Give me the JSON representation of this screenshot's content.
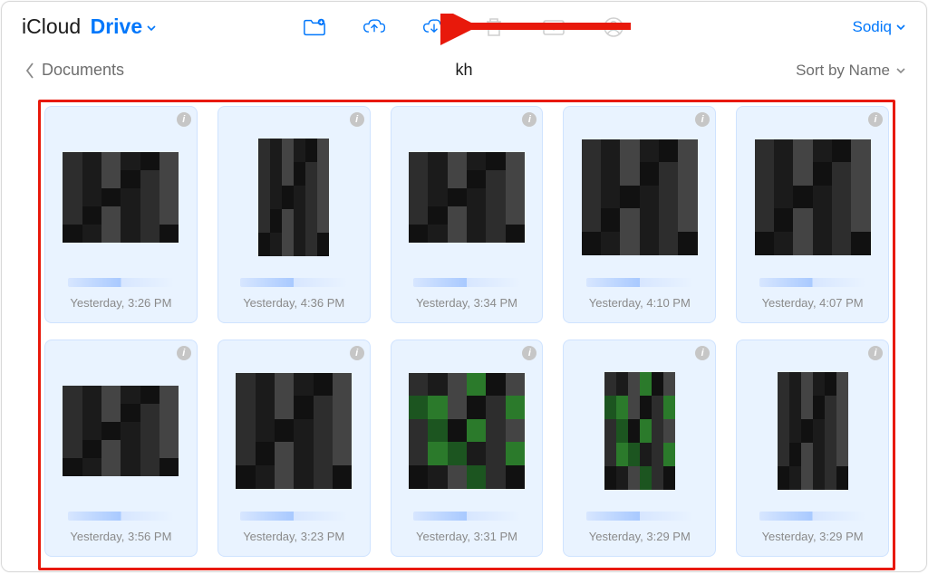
{
  "brand": {
    "part1": "iCloud",
    "part2": "Drive"
  },
  "user": "Sodiq",
  "nav": {
    "back_label": "Documents",
    "folder": "kh",
    "sort_label": "Sort by Name"
  },
  "toolbar": {
    "new_folder": "new-folder",
    "upload": "upload",
    "download": "download",
    "delete": "delete",
    "mail": "mail",
    "account": "account"
  },
  "tiles": [
    {
      "ts": "Yesterday, 3:26 PM",
      "shape": "wide",
      "variant": ""
    },
    {
      "ts": "Yesterday, 4:36 PM",
      "shape": "tall",
      "variant": ""
    },
    {
      "ts": "Yesterday, 3:34 PM",
      "shape": "wide",
      "variant": ""
    },
    {
      "ts": "Yesterday, 4:10 PM",
      "shape": "sq",
      "variant": ""
    },
    {
      "ts": "Yesterday, 4:07 PM",
      "shape": "sq",
      "variant": ""
    },
    {
      "ts": "Yesterday, 3:56 PM",
      "shape": "wide",
      "variant": ""
    },
    {
      "ts": "Yesterday, 3:23 PM",
      "shape": "sq",
      "variant": ""
    },
    {
      "ts": "Yesterday, 3:31 PM",
      "shape": "sq",
      "variant": "green"
    },
    {
      "ts": "Yesterday, 3:29 PM",
      "shape": "tall",
      "variant": "green"
    },
    {
      "ts": "Yesterday, 3:29 PM",
      "shape": "tall",
      "variant": ""
    }
  ]
}
